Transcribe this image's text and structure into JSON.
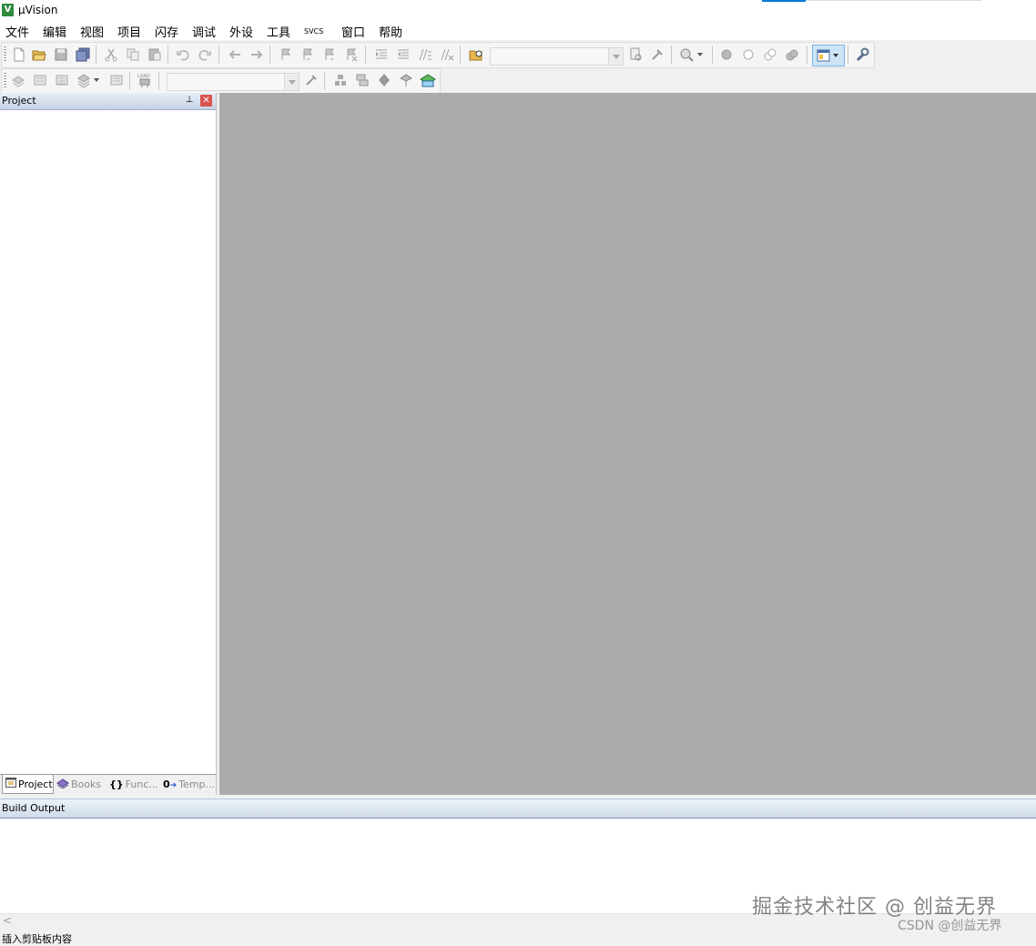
{
  "window": {
    "title": "µVision",
    "app_icon_letter": "V"
  },
  "menu": [
    "文件",
    "编辑",
    "视图",
    "项目",
    "闪存",
    "调试",
    "外设",
    "工具",
    "SVCS",
    "窗口",
    "帮助"
  ],
  "toolbar1": {
    "icons": [
      "new-file-icon",
      "open-folder-icon",
      "save-icon",
      "save-all-icon",
      "cut-icon",
      "copy-icon",
      "paste-icon",
      "undo-icon",
      "redo-icon",
      "nav-back-icon",
      "nav-forward-icon",
      "bookmark-icon",
      "prev-bookmark-icon",
      "next-bookmark-icon",
      "clear-bookmarks-icon",
      "indent-icon",
      "unindent-icon",
      "comment-icon",
      "uncomment-icon",
      "find-in-files-icon"
    ],
    "find_combo_value": "",
    "icons_after_combo": [
      "incremental-find-icon",
      "find-icon",
      "debug-session-icon",
      "breakpoint-icon",
      "disable-breakpoint-icon",
      "disable-all-breakpoints-icon",
      "kill-breakpoints-icon",
      "window-layout-icon",
      "configure-icon"
    ]
  },
  "toolbar2": {
    "icons": [
      "translate-icon",
      "build-icon",
      "rebuild-icon",
      "batch-build-icon",
      "stop-build-icon",
      "download-icon"
    ],
    "target_combo_value": "",
    "icons_after_combo": [
      "target-options-icon",
      "file-extensions-icon",
      "manage-components-icon",
      "select-packs-icon",
      "pack-installer-icon"
    ],
    "download_label": "LOAD"
  },
  "project_panel": {
    "title": "Project",
    "tabs": [
      {
        "label": "Project",
        "icon": "project-tab-icon",
        "active": true
      },
      {
        "label": "Books",
        "icon": "books-tab-icon",
        "active": false
      },
      {
        "label": "Func...",
        "icon": "functions-tab-icon",
        "prefix": "{}",
        "active": false
      },
      {
        "label": "Temp...",
        "icon": "templates-tab-icon",
        "prefix": "0",
        "active": false
      }
    ]
  },
  "build_output": {
    "title": "Build Output"
  },
  "status_bar": {
    "text": "插入剪贴板内容"
  },
  "watermark": {
    "line1": "掘金技术社区 @ 创益无界",
    "line2": "CSDN @创益无界"
  },
  "colors": {
    "editor_bg": "#ababab",
    "panel_header": "#c6d3e6",
    "app_icon": "#2e8b3d"
  }
}
